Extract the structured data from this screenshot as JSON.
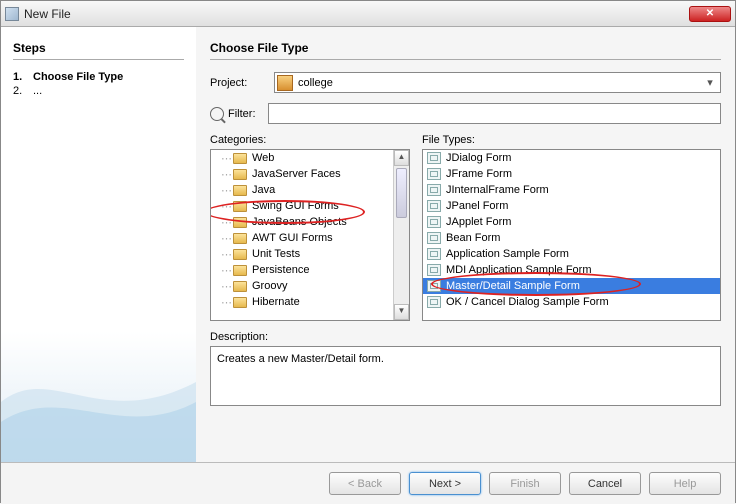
{
  "window": {
    "title": "New File"
  },
  "sidebar": {
    "heading": "Steps",
    "items": [
      {
        "num": "1.",
        "label": "Choose File Type",
        "current": true
      },
      {
        "num": "2.",
        "label": "...",
        "current": false
      }
    ]
  },
  "main": {
    "heading": "Choose File Type",
    "project_label": "Project:",
    "project_value": "college",
    "filter_label": "Filter:",
    "filter_value": "",
    "categories_label": "Categories:",
    "filetypes_label": "File Types:",
    "categories": [
      "Web",
      "JavaServer Faces",
      "Java",
      "Swing GUI Forms",
      "JavaBeans Objects",
      "AWT GUI Forms",
      "Unit Tests",
      "Persistence",
      "Groovy",
      "Hibernate"
    ],
    "filetypes": [
      {
        "name": "JDialog Form",
        "selected": false
      },
      {
        "name": "JFrame Form",
        "selected": false
      },
      {
        "name": "JInternalFrame Form",
        "selected": false
      },
      {
        "name": "JPanel Form",
        "selected": false
      },
      {
        "name": "JApplet Form",
        "selected": false
      },
      {
        "name": "Bean Form",
        "selected": false
      },
      {
        "name": "Application Sample Form",
        "selected": false
      },
      {
        "name": "MDI Application Sample Form",
        "selected": false
      },
      {
        "name": "Master/Detail Sample Form",
        "selected": true
      },
      {
        "name": "OK / Cancel Dialog Sample Form",
        "selected": false
      }
    ],
    "description_label": "Description:",
    "description_text": "Creates a new Master/Detail form."
  },
  "footer": {
    "back": "< Back",
    "next": "Next >",
    "finish": "Finish",
    "cancel": "Cancel",
    "help": "Help"
  }
}
